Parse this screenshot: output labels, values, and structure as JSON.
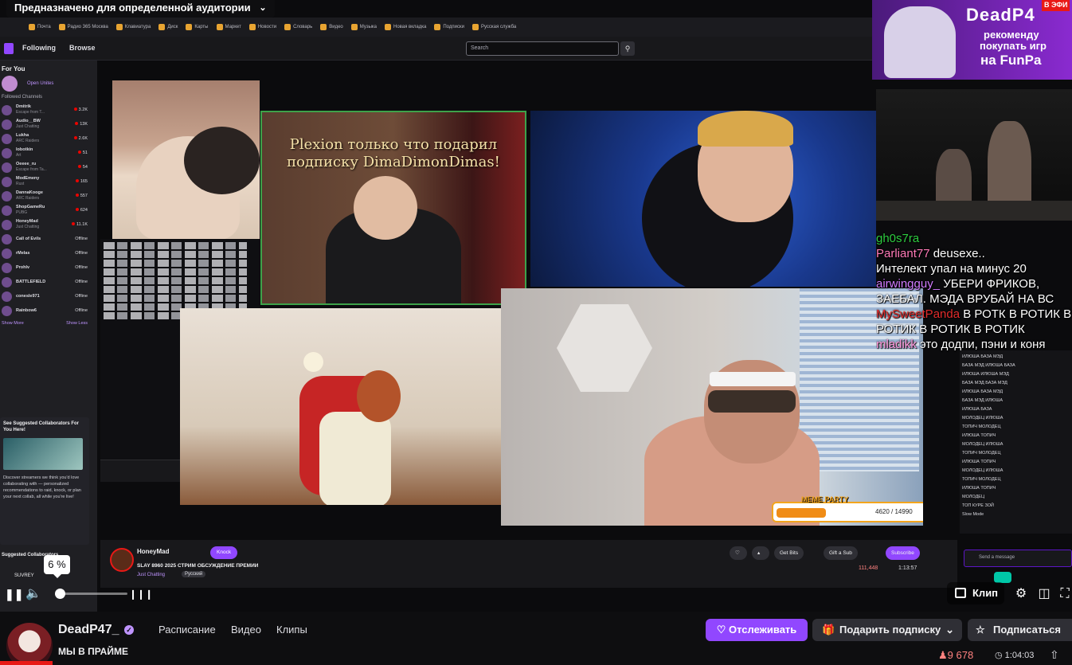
{
  "audience_dropdown": {
    "label": "Предназначено для определенной аудитории"
  },
  "inner_browser": {
    "bookmarks": [
      "Почта",
      "Радио 365 Москва",
      "Клавиатура",
      "Диск",
      "Карты",
      "Маркет",
      "Новости",
      "Словарь",
      "Видео",
      "Музыка",
      "Новая вкладка",
      "Подписки",
      "Русская служба"
    ],
    "nav": {
      "following": "Following",
      "browse": "Browse"
    },
    "search_placeholder": "Search"
  },
  "inner_sidebar": {
    "header": "For You",
    "open_unites": "Open Unites",
    "followed_header": "Followed Channels",
    "channels": [
      {
        "name": "Dmitrik",
        "sub": "Escape from T...",
        "viewers": "3.2K"
      },
      {
        "name": "Audio__BW",
        "sub": "Just Chatting",
        "viewers": "13K"
      },
      {
        "name": "Lukha",
        "sub": "ARC Raiders",
        "viewers": "2.6K"
      },
      {
        "name": "lobotkin",
        "sub": "Art",
        "viewers": "51"
      },
      {
        "name": "Oeeee_ru",
        "sub": "Escape from Ta...",
        "viewers": "54"
      },
      {
        "name": "ModEmeny",
        "sub": "Rust",
        "viewers": "165"
      },
      {
        "name": "DannaKooge",
        "sub": "ARC Raiders",
        "viewers": "557"
      },
      {
        "name": "ShopGameRu",
        "sub": "PUBG",
        "viewers": "624"
      },
      {
        "name": "HoneyMad",
        "sub": "Just Chatting",
        "viewers": "11.1K"
      },
      {
        "name": "Call of Evils",
        "sub": "",
        "viewers": "Offline"
      },
      {
        "name": "rMelas",
        "sub": "",
        "viewers": "Offline"
      },
      {
        "name": "Prohlv",
        "sub": "",
        "viewers": "Offline"
      },
      {
        "name": "BATTLEFIELD",
        "sub": "",
        "viewers": "Offline"
      },
      {
        "name": "conesle971",
        "sub": "",
        "viewers": "Offline"
      },
      {
        "name": "Rainbow6",
        "sub": "",
        "viewers": "Offline"
      }
    ],
    "show_more": "Show More",
    "show_less": "Show Less",
    "suggest_title": "See Suggested Collaborators For You Here!",
    "suggest_desc": "Discover streamers we think you'd love collaborating with — personalized recommendations to raid, knock, or plan your next collab, all while you're live!",
    "suggested_header": "Suggested Collaborators",
    "suggested_item": "SUVREY"
  },
  "overlay": {
    "plexion_text": "Plexion только что подарил подписку DimaDimonDimas!",
    "meme_party": "MEME PARTY",
    "meme_progress_text": "4620 / 14990",
    "meme_progress": 0.31
  },
  "right_panel": {
    "funpay_line1": "DeadP4",
    "funpay_line2": "рекоменду",
    "funpay_line3": "покупать игр",
    "funpay_line4": "на FunPa",
    "live_tag": "В ЭФИ",
    "big_chat": [
      {
        "user": "gh0s7ra",
        "text": ""
      },
      {
        "user": "Parliant77",
        "text": "deusexe.."
      },
      {
        "user": "",
        "text": "Интелект упал на минус 20"
      },
      {
        "user": "airwingguy_",
        "text": "УБЕРИ ФРИКОВ, ЗАЕБАЛ. МЭДА ВРУБАЙ НА ВС"
      },
      {
        "user": "MySweetPanda",
        "text": "В РОТК В РОТИК В РОТИК В РОТИК В РОТИК"
      },
      {
        "user": "mladikk",
        "text": "это додпи, пэни и коня"
      }
    ],
    "small_chat": [
      "ИЛЮША БАЗА МЭД",
      "БАЗА МЭД ИЛЮША БАЗА",
      "ИЛЮША ИЛЮША МЭД",
      "БАЗА МЭД БАЗА МЭД",
      "ИЛЮША БАЗА МЭД",
      "БАЗА МЭД ИЛЮША",
      "ИЛЮША БАЗА",
      "МОЛОДЕЦ ИЛЮША",
      "ТОПИЧ МОЛОДЕЦ",
      "ИЛЮША ТОПИЧ",
      "МОЛОДЕЦ ИЛЮША",
      "ТОПИЧ МОЛОДЕЦ",
      "ИЛЮША ТОПИЧ",
      "МОЛОДЕЦ ИЛЮША",
      "ТОПИЧ МОЛОДЕЦ",
      "ИЛЮША ТОПИЧ",
      "МОЛОДЕЦ",
      "ТОП КУРЕ ЗОЙ",
      "Slow Mode"
    ],
    "send_placeholder": "Send a message"
  },
  "inner_stream": {
    "channel": "HoneyMad",
    "knock": "Knock",
    "title": "SLAY 8960 2025 СТРИМ ОБСУЖДЕНИЕ ПРЕМИИ",
    "category": "Just Chatting",
    "language": "Русский",
    "get_bits": "Get Bits",
    "gift_sub": "Gift a Sub",
    "subscribe": "Subscribe",
    "viewers": "111,448",
    "uptime": "1:13:57"
  },
  "player": {
    "volume_label": "6 %",
    "volume": 0.06,
    "clip_label": "Клип"
  },
  "channel": {
    "name": "DeadP47_",
    "tabs": [
      "Расписание",
      "Видео",
      "Клипы"
    ],
    "stream_title": "МЫ В ПРАЙМЕ",
    "follow_label": "Отслеживать",
    "gift_label": "Подарить подписку",
    "subscribe_label": "Подписаться",
    "viewers": "9 678",
    "uptime": "1:04:03"
  },
  "colors": {
    "accent": "#9147ff",
    "live": "#e91916",
    "viewer_count": "#ff8280"
  }
}
